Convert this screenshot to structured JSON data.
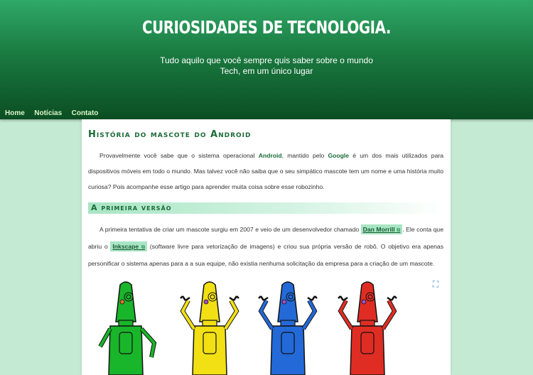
{
  "header": {
    "title": "CURIOSIDADES DE TECNOLOGIA.",
    "subtitle": "Tudo aquilo que você sempre quis saber sobre o mundo Tech, em um único lugar"
  },
  "nav": {
    "items": [
      "Home",
      "Notícias",
      "Contato"
    ]
  },
  "article": {
    "title": "História do mascote do Android",
    "p1": {
      "t1": "Provavelmente você sabe que o sistema operacional ",
      "b1": "Android",
      "t2": ", mantido pelo ",
      "b2": "Google",
      "t3": " é um dos mais utilizados para dispositivos móveis em todo o mundo. Mas talvez você não saiba que o seu simpático mascote tem um nome e uma história muito curiosa? Pois acompanhe esse artigo para aprender muita coisa sobre esse robozinho."
    },
    "section_title": "A primeira versão",
    "p2": {
      "t1": "A primeira tentativa de criar um mascote surgiu em 2007 e veio de um desenvolvedor chamado ",
      "link1": "Dan Morrill",
      "t2": ". Ele conta que abriu o ",
      "link2": "Inkscape",
      "t3": " (software livre para vetorização de imagens) e criou sua própria versão de robô. O objetivo era apenas personificar o sistema apenas para a a sua equipe, não existia nenhuma solicitação da empresa para a criação de um mascote."
    },
    "ext_icon": "external-link-icon",
    "zoom_icon": "expand-icon",
    "robot_colors": [
      "#19b52a",
      "#f2e014",
      "#2369d8",
      "#e02d24"
    ]
  }
}
